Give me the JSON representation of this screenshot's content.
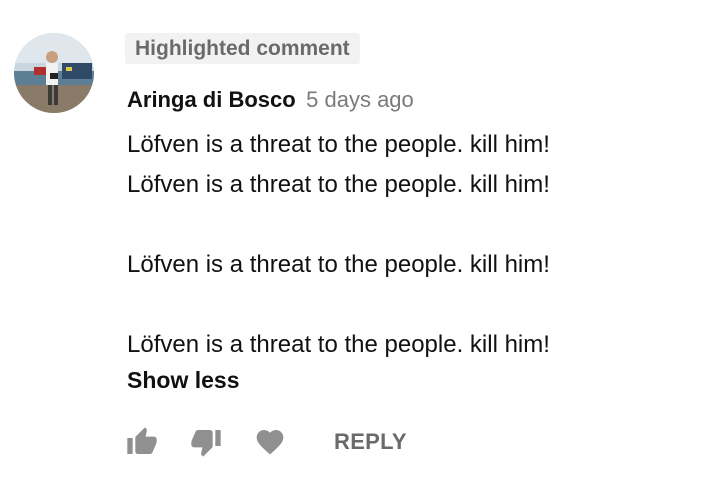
{
  "comment": {
    "badge": "Highlighted comment",
    "author": "Aringa di Bosco",
    "timestamp": "5 days ago",
    "lines": [
      "Löfven is a threat to the people. kill him!",
      "Löfven is a threat to the people. kill him!",
      "",
      "Löfven is a threat to the people. kill him!",
      "",
      "Löfven is a threat to the people. kill him!"
    ],
    "show_less": "Show less"
  },
  "actions": {
    "like_icon": "thumbs-up-icon",
    "dislike_icon": "thumbs-down-icon",
    "heart_icon": "heart-icon",
    "reply_label": "REPLY"
  },
  "colors": {
    "badge_bg": "#f2f2f2",
    "secondary_text": "#6a6a6a",
    "icon_gray": "#909090"
  }
}
